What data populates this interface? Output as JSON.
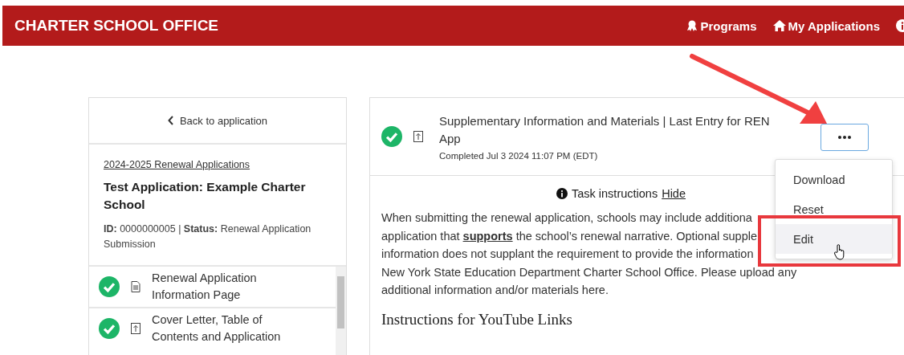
{
  "header": {
    "title": "CHARTER SCHOOL OFFICE",
    "nav": [
      {
        "label": "Programs"
      },
      {
        "label": "My Applications"
      }
    ]
  },
  "sidebar": {
    "back_link": "Back to application",
    "program_link": "2024-2025 Renewal Applications",
    "application_title": "Test Application: Example Charter School",
    "meta": "**ID:** 0000000005 | **Status:** Renewal Application Submission",
    "tasks": [
      {
        "title": "Renewal Application Information Page",
        "completed": true,
        "kind": "document"
      },
      {
        "title": "Cover Letter, Table of Contents and Application",
        "completed": true,
        "kind": "upload"
      }
    ]
  },
  "task": {
    "title": "Supplementary Information and Materials | Last Entry for REN App",
    "completed": true,
    "kind": "upload",
    "status": "Completed Jul 3 2024 11:07 PM (EDT)",
    "menu": [
      {
        "label": "Download",
        "selected": false
      },
      {
        "label": "Reset",
        "selected": false
      },
      {
        "label": "Edit",
        "selected": true
      }
    ],
    "instructions_label": "Task instructions",
    "instructions_toggle": "Hide",
    "paragraph_lines": [
      "When submitting the renewal application, schools may include additiona",
      "application that **supports** the school’s renewal narrative. Optional supple",
      "information does not supplant the requirement to provide the information",
      "New York State Education Department Charter School Office. Please upload any",
      "additional information and/or materials here."
    ],
    "heading": "Instructions for YouTube Links"
  }
}
